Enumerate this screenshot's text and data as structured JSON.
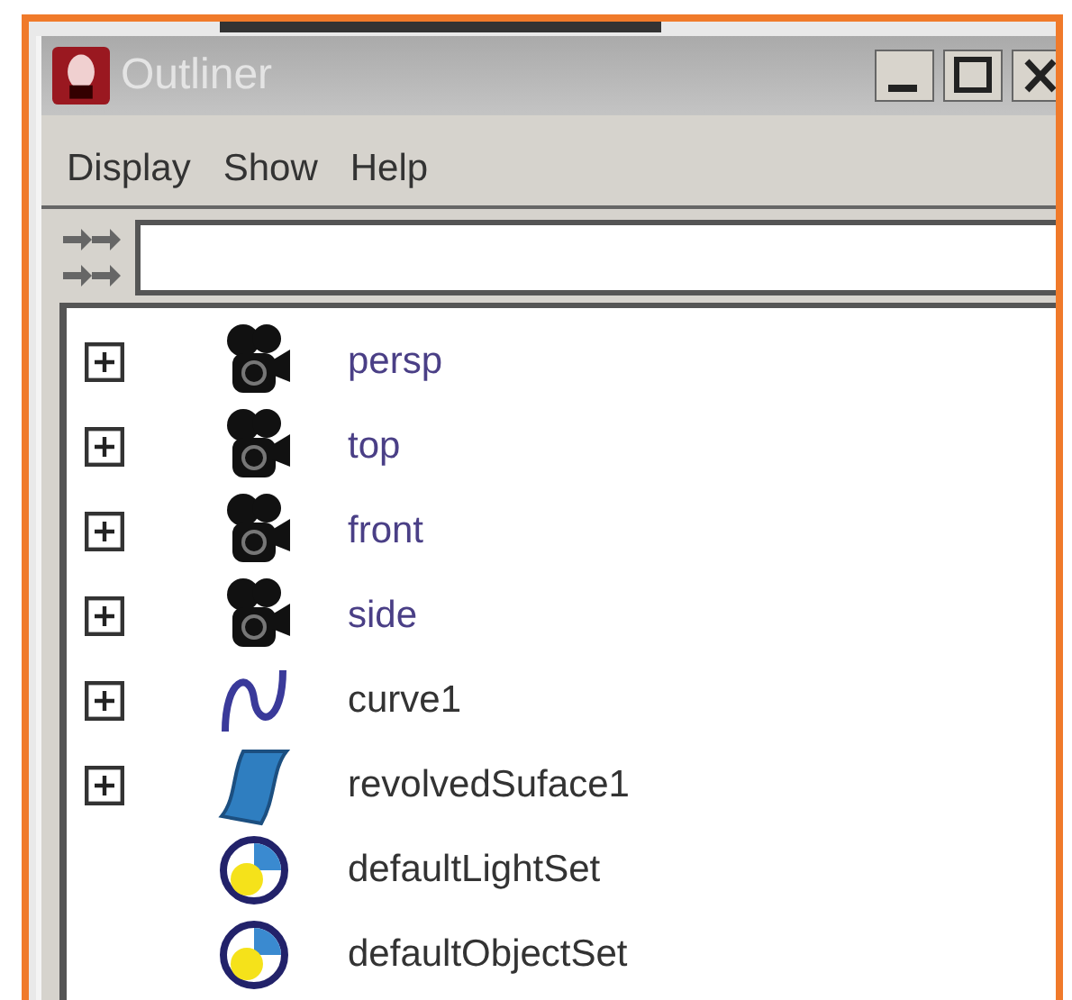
{
  "window": {
    "title": "Outliner"
  },
  "menu": [
    "Display",
    "Show",
    "Help"
  ],
  "items": [
    {
      "label": "persp",
      "kind": "camera",
      "expandable": true
    },
    {
      "label": "top",
      "kind": "camera",
      "expandable": true
    },
    {
      "label": "front",
      "kind": "camera",
      "expandable": true
    },
    {
      "label": "side",
      "kind": "camera",
      "expandable": true
    },
    {
      "label": "curve1",
      "kind": "curve",
      "expandable": true
    },
    {
      "label": "revolvedSuface1",
      "kind": "surface",
      "expandable": true
    },
    {
      "label": "defaultLightSet",
      "kind": "set",
      "expandable": false
    },
    {
      "label": "defaultObjectSet",
      "kind": "set",
      "expandable": false
    }
  ]
}
